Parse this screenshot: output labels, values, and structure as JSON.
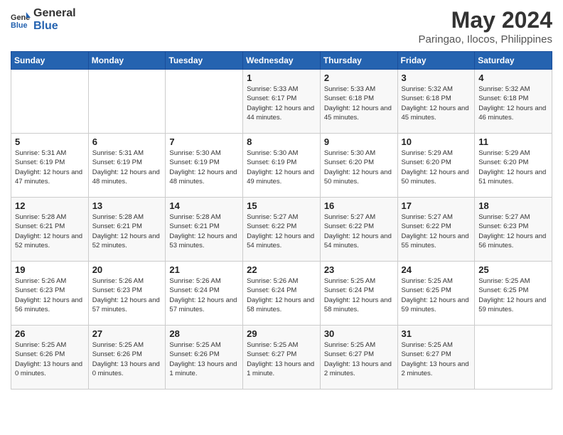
{
  "logo": {
    "line1": "General",
    "line2": "Blue"
  },
  "title": "May 2024",
  "subtitle": "Paringao, Ilocos, Philippines",
  "weekdays": [
    "Sunday",
    "Monday",
    "Tuesday",
    "Wednesday",
    "Thursday",
    "Friday",
    "Saturday"
  ],
  "weeks": [
    [
      {
        "day": "",
        "sunrise": "",
        "sunset": "",
        "daylight": ""
      },
      {
        "day": "",
        "sunrise": "",
        "sunset": "",
        "daylight": ""
      },
      {
        "day": "",
        "sunrise": "",
        "sunset": "",
        "daylight": ""
      },
      {
        "day": "1",
        "sunrise": "Sunrise: 5:33 AM",
        "sunset": "Sunset: 6:17 PM",
        "daylight": "Daylight: 12 hours and 44 minutes."
      },
      {
        "day": "2",
        "sunrise": "Sunrise: 5:33 AM",
        "sunset": "Sunset: 6:18 PM",
        "daylight": "Daylight: 12 hours and 45 minutes."
      },
      {
        "day": "3",
        "sunrise": "Sunrise: 5:32 AM",
        "sunset": "Sunset: 6:18 PM",
        "daylight": "Daylight: 12 hours and 45 minutes."
      },
      {
        "day": "4",
        "sunrise": "Sunrise: 5:32 AM",
        "sunset": "Sunset: 6:18 PM",
        "daylight": "Daylight: 12 hours and 46 minutes."
      }
    ],
    [
      {
        "day": "5",
        "sunrise": "Sunrise: 5:31 AM",
        "sunset": "Sunset: 6:19 PM",
        "daylight": "Daylight: 12 hours and 47 minutes."
      },
      {
        "day": "6",
        "sunrise": "Sunrise: 5:31 AM",
        "sunset": "Sunset: 6:19 PM",
        "daylight": "Daylight: 12 hours and 48 minutes."
      },
      {
        "day": "7",
        "sunrise": "Sunrise: 5:30 AM",
        "sunset": "Sunset: 6:19 PM",
        "daylight": "Daylight: 12 hours and 48 minutes."
      },
      {
        "day": "8",
        "sunrise": "Sunrise: 5:30 AM",
        "sunset": "Sunset: 6:19 PM",
        "daylight": "Daylight: 12 hours and 49 minutes."
      },
      {
        "day": "9",
        "sunrise": "Sunrise: 5:30 AM",
        "sunset": "Sunset: 6:20 PM",
        "daylight": "Daylight: 12 hours and 50 minutes."
      },
      {
        "day": "10",
        "sunrise": "Sunrise: 5:29 AM",
        "sunset": "Sunset: 6:20 PM",
        "daylight": "Daylight: 12 hours and 50 minutes."
      },
      {
        "day": "11",
        "sunrise": "Sunrise: 5:29 AM",
        "sunset": "Sunset: 6:20 PM",
        "daylight": "Daylight: 12 hours and 51 minutes."
      }
    ],
    [
      {
        "day": "12",
        "sunrise": "Sunrise: 5:28 AM",
        "sunset": "Sunset: 6:21 PM",
        "daylight": "Daylight: 12 hours and 52 minutes."
      },
      {
        "day": "13",
        "sunrise": "Sunrise: 5:28 AM",
        "sunset": "Sunset: 6:21 PM",
        "daylight": "Daylight: 12 hours and 52 minutes."
      },
      {
        "day": "14",
        "sunrise": "Sunrise: 5:28 AM",
        "sunset": "Sunset: 6:21 PM",
        "daylight": "Daylight: 12 hours and 53 minutes."
      },
      {
        "day": "15",
        "sunrise": "Sunrise: 5:27 AM",
        "sunset": "Sunset: 6:22 PM",
        "daylight": "Daylight: 12 hours and 54 minutes."
      },
      {
        "day": "16",
        "sunrise": "Sunrise: 5:27 AM",
        "sunset": "Sunset: 6:22 PM",
        "daylight": "Daylight: 12 hours and 54 minutes."
      },
      {
        "day": "17",
        "sunrise": "Sunrise: 5:27 AM",
        "sunset": "Sunset: 6:22 PM",
        "daylight": "Daylight: 12 hours and 55 minutes."
      },
      {
        "day": "18",
        "sunrise": "Sunrise: 5:27 AM",
        "sunset": "Sunset: 6:23 PM",
        "daylight": "Daylight: 12 hours and 56 minutes."
      }
    ],
    [
      {
        "day": "19",
        "sunrise": "Sunrise: 5:26 AM",
        "sunset": "Sunset: 6:23 PM",
        "daylight": "Daylight: 12 hours and 56 minutes."
      },
      {
        "day": "20",
        "sunrise": "Sunrise: 5:26 AM",
        "sunset": "Sunset: 6:23 PM",
        "daylight": "Daylight: 12 hours and 57 minutes."
      },
      {
        "day": "21",
        "sunrise": "Sunrise: 5:26 AM",
        "sunset": "Sunset: 6:24 PM",
        "daylight": "Daylight: 12 hours and 57 minutes."
      },
      {
        "day": "22",
        "sunrise": "Sunrise: 5:26 AM",
        "sunset": "Sunset: 6:24 PM",
        "daylight": "Daylight: 12 hours and 58 minutes."
      },
      {
        "day": "23",
        "sunrise": "Sunrise: 5:25 AM",
        "sunset": "Sunset: 6:24 PM",
        "daylight": "Daylight: 12 hours and 58 minutes."
      },
      {
        "day": "24",
        "sunrise": "Sunrise: 5:25 AM",
        "sunset": "Sunset: 6:25 PM",
        "daylight": "Daylight: 12 hours and 59 minutes."
      },
      {
        "day": "25",
        "sunrise": "Sunrise: 5:25 AM",
        "sunset": "Sunset: 6:25 PM",
        "daylight": "Daylight: 12 hours and 59 minutes."
      }
    ],
    [
      {
        "day": "26",
        "sunrise": "Sunrise: 5:25 AM",
        "sunset": "Sunset: 6:26 PM",
        "daylight": "Daylight: 13 hours and 0 minutes."
      },
      {
        "day": "27",
        "sunrise": "Sunrise: 5:25 AM",
        "sunset": "Sunset: 6:26 PM",
        "daylight": "Daylight: 13 hours and 0 minutes."
      },
      {
        "day": "28",
        "sunrise": "Sunrise: 5:25 AM",
        "sunset": "Sunset: 6:26 PM",
        "daylight": "Daylight: 13 hours and 1 minute."
      },
      {
        "day": "29",
        "sunrise": "Sunrise: 5:25 AM",
        "sunset": "Sunset: 6:27 PM",
        "daylight": "Daylight: 13 hours and 1 minute."
      },
      {
        "day": "30",
        "sunrise": "Sunrise: 5:25 AM",
        "sunset": "Sunset: 6:27 PM",
        "daylight": "Daylight: 13 hours and 2 minutes."
      },
      {
        "day": "31",
        "sunrise": "Sunrise: 5:25 AM",
        "sunset": "Sunset: 6:27 PM",
        "daylight": "Daylight: 13 hours and 2 minutes."
      },
      {
        "day": "",
        "sunrise": "",
        "sunset": "",
        "daylight": ""
      }
    ]
  ]
}
